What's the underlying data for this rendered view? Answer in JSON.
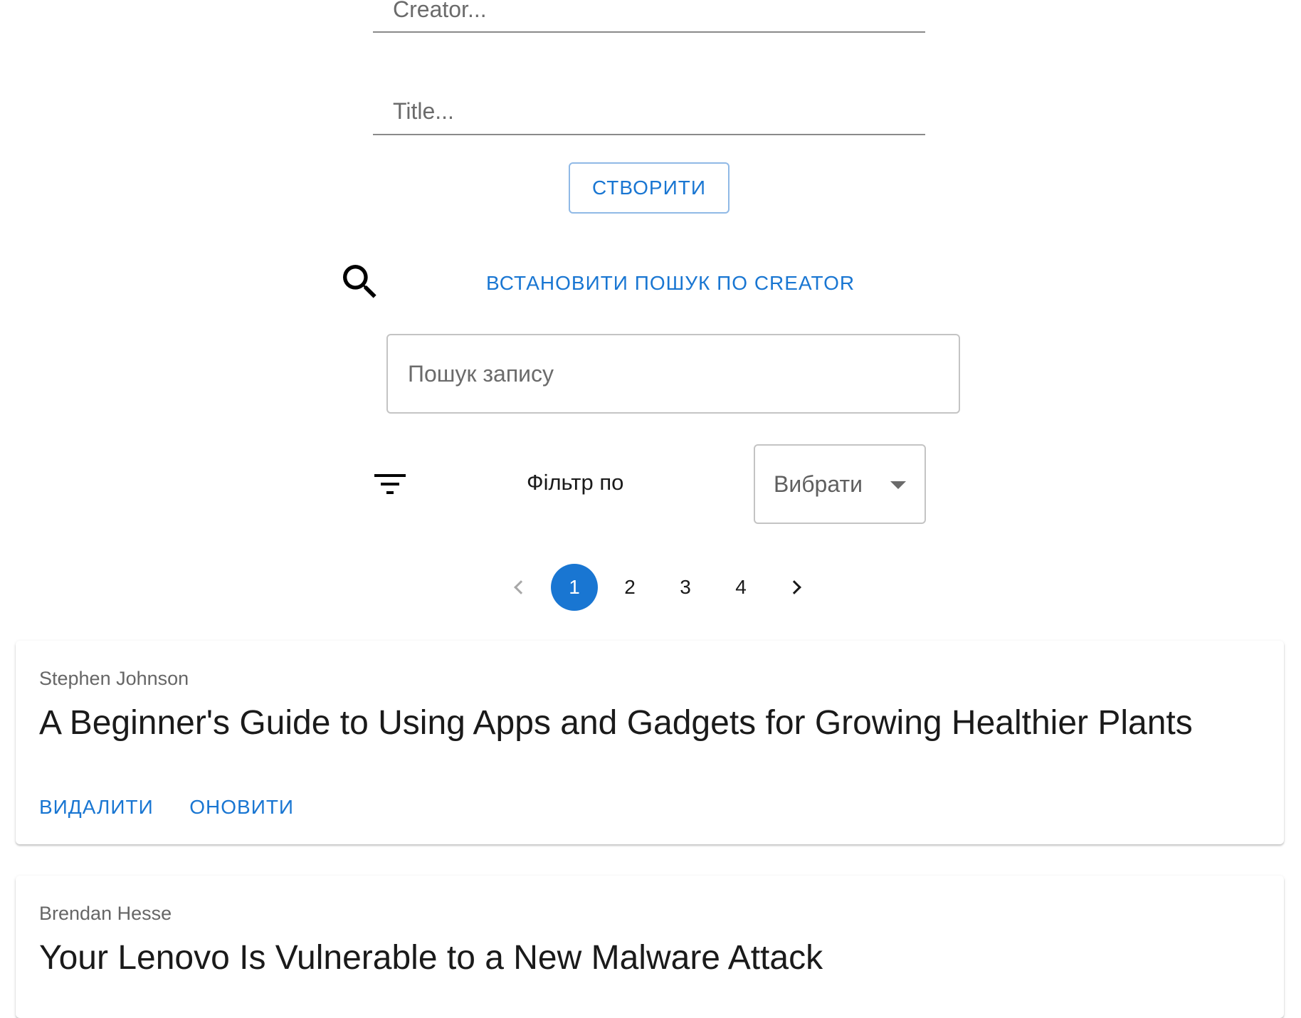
{
  "form": {
    "creator_placeholder": "Creator...",
    "title_placeholder": "Title...",
    "create_label": "СТВОРИТИ"
  },
  "search": {
    "mode_label": "ВСТАНОВИТИ ПОШУК ПО CREATOR",
    "placeholder": "Пошук запису",
    "icon": "search-icon"
  },
  "filter": {
    "label": "Фільтр по",
    "select_value": "Вибрати",
    "icon": "filter-icon"
  },
  "pagination": {
    "pages": [
      "1",
      "2",
      "3",
      "4"
    ],
    "current": "1"
  },
  "records": [
    {
      "author": "Stephen Johnson",
      "title": "A Beginner's Guide to Using Apps and Gadgets for Growing Healthier Plants",
      "delete_label": "ВИДАЛИТИ",
      "update_label": "ОНОВИТИ"
    },
    {
      "author": "Brendan Hesse",
      "title": "Your Lenovo Is Vulnerable to a New Malware Attack"
    }
  ],
  "colors": {
    "primary": "#1976d2",
    "outline": "#c4c4c4"
  }
}
